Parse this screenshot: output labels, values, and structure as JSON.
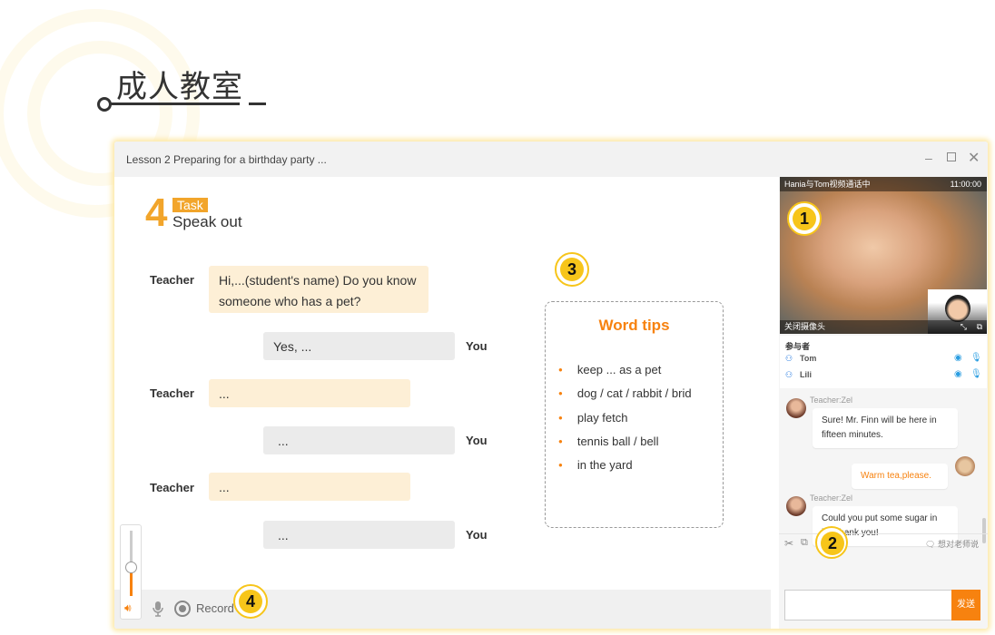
{
  "page": {
    "heading": "成人教室"
  },
  "window": {
    "title": "Lesson 2  Preparing for a birthday party ...",
    "minimize_icon": "minimize-icon",
    "maximize_icon": "maximize-icon",
    "close_icon": "close-icon"
  },
  "task": {
    "number": "4",
    "tag": "Task",
    "title": "Speak out"
  },
  "dialogue": [
    {
      "speaker": "Teacher",
      "text": "Hi,...(student's name) Do you know someone who has a pet?"
    },
    {
      "speaker": "You",
      "text": "Yes, ..."
    },
    {
      "speaker": "Teacher",
      "text": "..."
    },
    {
      "speaker": "You",
      "text": "..."
    },
    {
      "speaker": "Teacher",
      "text": "..."
    },
    {
      "speaker": "You",
      "text": "..."
    }
  ],
  "word_tips": {
    "title": "Word tips",
    "items": [
      "keep ... as a pet",
      "dog / cat / rabbit / brid",
      "play fetch",
      "tennis ball / bell",
      "in the yard"
    ]
  },
  "bottom_bar": {
    "record_label": "Record",
    "volume_percent": 45
  },
  "badges": [
    "1",
    "2",
    "3",
    "4"
  ],
  "video": {
    "caption": "Hania与Tom视频通话中",
    "time": "11:00:00",
    "camera_off_label": "关闭摄像头"
  },
  "participants": {
    "title": "参与者",
    "list": [
      {
        "name": "Tom"
      },
      {
        "name": "Lili"
      }
    ]
  },
  "chat": {
    "messages": [
      {
        "sender": "Teacher:Zel",
        "text": "Sure! Mr. Finn will be here in fifteen minutes."
      },
      {
        "sender": "",
        "text": "Warm tea,please."
      },
      {
        "sender": "Teacher:Zel",
        "text": "Could you put some sugar in it? Thank you!"
      }
    ],
    "say_to_teacher": "想对老师说",
    "input_value": "",
    "send_label": "发送"
  },
  "colors": {
    "accent": "#f7820f",
    "badge": "#f7c51a",
    "bubble_teacher": "#fdefd6",
    "bubble_you": "#ebebeb"
  }
}
